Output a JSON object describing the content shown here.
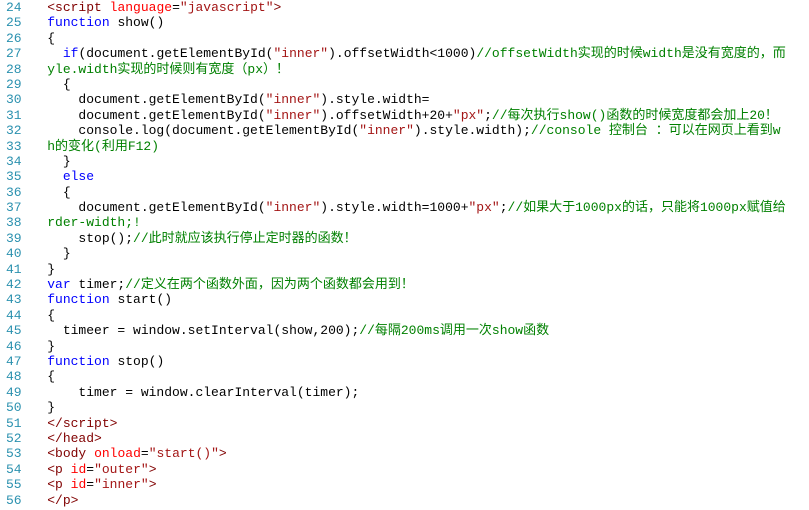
{
  "lineStart": 24,
  "lineEnd": 56,
  "lines": {
    "l24": {
      "indent": "  ",
      "parts": [
        {
          "t": "<",
          "c": "tag"
        },
        {
          "t": "script",
          "c": "tag"
        },
        {
          "t": " ",
          "c": "plain"
        },
        {
          "t": "language",
          "c": "attr"
        },
        {
          "t": "=",
          "c": "plain"
        },
        {
          "t": "\"javascript\"",
          "c": "str"
        },
        {
          "t": ">",
          "c": "tag"
        }
      ]
    },
    "l25": {
      "indent": "  ",
      "parts": [
        {
          "t": "function",
          "c": "kw"
        },
        {
          "t": " show()",
          "c": "plain"
        }
      ]
    },
    "l26": {
      "indent": "  ",
      "parts": [
        {
          "t": "{",
          "c": "plain"
        }
      ]
    },
    "l27": {
      "indent": "    ",
      "parts": [
        {
          "t": "if",
          "c": "kw"
        },
        {
          "t": "(document.getElementById(",
          "c": "plain"
        },
        {
          "t": "\"inner\"",
          "c": "str"
        },
        {
          "t": ").offsetWidth<1000)",
          "c": "plain"
        },
        {
          "t": "//offsetWidth实现的时候width是没有宽度的，而",
          "c": "cm"
        }
      ]
    },
    "l28": {
      "indent": "  ",
      "parts": [
        {
          "t": "yle.width实现的时候则有宽度（px）！",
          "c": "cm"
        }
      ]
    },
    "l29": {
      "indent": "    ",
      "parts": [
        {
          "t": "{",
          "c": "plain"
        }
      ]
    },
    "l30": {
      "indent": "      ",
      "parts": [
        {
          "t": "document.getElementById(",
          "c": "plain"
        },
        {
          "t": "\"inner\"",
          "c": "str"
        },
        {
          "t": ").style.width=",
          "c": "plain"
        }
      ]
    },
    "l31": {
      "indent": "      ",
      "parts": [
        {
          "t": "document.getElementById(",
          "c": "plain"
        },
        {
          "t": "\"inner\"",
          "c": "str"
        },
        {
          "t": ").offsetWidth+20+",
          "c": "plain"
        },
        {
          "t": "\"px\"",
          "c": "str"
        },
        {
          "t": ";",
          "c": "plain"
        },
        {
          "t": "//每次执行show()函数的时候宽度都会加上20！",
          "c": "cm"
        }
      ]
    },
    "l32": {
      "indent": "      ",
      "parts": [
        {
          "t": "console.log(document.getElementById(",
          "c": "plain"
        },
        {
          "t": "\"inner\"",
          "c": "str"
        },
        {
          "t": ").style.width);",
          "c": "plain"
        },
        {
          "t": "//console 控制台 ：可以在网页上看到w",
          "c": "cm"
        }
      ]
    },
    "l33": {
      "indent": "  ",
      "parts": [
        {
          "t": "h的变化(利用F12)",
          "c": "cm"
        }
      ]
    },
    "l34": {
      "indent": "    ",
      "parts": [
        {
          "t": "}",
          "c": "plain"
        }
      ]
    },
    "l35": {
      "indent": "    ",
      "parts": [
        {
          "t": "else",
          "c": "kw"
        }
      ]
    },
    "l36": {
      "indent": "    ",
      "parts": [
        {
          "t": "{",
          "c": "plain"
        }
      ]
    },
    "l37": {
      "indent": "      ",
      "parts": [
        {
          "t": "document.getElementById(",
          "c": "plain"
        },
        {
          "t": "\"inner\"",
          "c": "str"
        },
        {
          "t": ").style.width=1000+",
          "c": "plain"
        },
        {
          "t": "\"px\"",
          "c": "str"
        },
        {
          "t": ";",
          "c": "plain"
        },
        {
          "t": "//如果大于1000px的话，只能将1000px赋值给",
          "c": "cm"
        }
      ]
    },
    "l38": {
      "indent": "  ",
      "parts": [
        {
          "t": "rder-width;!",
          "c": "cm"
        }
      ]
    },
    "l39": {
      "indent": "      ",
      "parts": [
        {
          "t": "stop();",
          "c": "plain"
        },
        {
          "t": "//此时就应该执行停止定时器的函数！",
          "c": "cm"
        }
      ]
    },
    "l40": {
      "indent": "    ",
      "parts": [
        {
          "t": "}",
          "c": "plain"
        }
      ]
    },
    "l41": {
      "indent": "  ",
      "parts": [
        {
          "t": "}",
          "c": "plain"
        }
      ]
    },
    "l42": {
      "indent": "  ",
      "parts": [
        {
          "t": "var",
          "c": "kw"
        },
        {
          "t": " timer;",
          "c": "plain"
        },
        {
          "t": "//定义在两个函数外面，因为两个函数都会用到！",
          "c": "cm"
        }
      ]
    },
    "l43": {
      "indent": "  ",
      "parts": [
        {
          "t": "function",
          "c": "kw"
        },
        {
          "t": " start()",
          "c": "plain"
        }
      ]
    },
    "l44": {
      "indent": "  ",
      "parts": [
        {
          "t": "{",
          "c": "plain"
        }
      ]
    },
    "l45": {
      "indent": "    ",
      "parts": [
        {
          "t": "timeer = window.setInterval(show,200);",
          "c": "plain"
        },
        {
          "t": "//每隔200ms调用一次show函数",
          "c": "cm"
        }
      ]
    },
    "l46": {
      "indent": "  ",
      "parts": [
        {
          "t": "}",
          "c": "plain"
        }
      ]
    },
    "l47": {
      "indent": "  ",
      "parts": [
        {
          "t": "function",
          "c": "kw"
        },
        {
          "t": " stop()",
          "c": "plain"
        }
      ]
    },
    "l48": {
      "indent": "  ",
      "parts": [
        {
          "t": "{",
          "c": "plain"
        }
      ]
    },
    "l49": {
      "indent": "      ",
      "parts": [
        {
          "t": "timer = window.clearInterval(timer);",
          "c": "plain"
        }
      ]
    },
    "l50": {
      "indent": "  ",
      "parts": [
        {
          "t": "}",
          "c": "plain"
        }
      ]
    },
    "l51": {
      "indent": "  ",
      "parts": [
        {
          "t": "</",
          "c": "tag"
        },
        {
          "t": "script",
          "c": "tag"
        },
        {
          "t": ">",
          "c": "tag"
        }
      ]
    },
    "l52": {
      "indent": "  ",
      "parts": [
        {
          "t": "</",
          "c": "tag"
        },
        {
          "t": "head",
          "c": "tag"
        },
        {
          "t": ">",
          "c": "tag"
        }
      ]
    },
    "l53": {
      "indent": "  ",
      "parts": [
        {
          "t": "<",
          "c": "tag"
        },
        {
          "t": "body",
          "c": "tag"
        },
        {
          "t": " ",
          "c": "plain"
        },
        {
          "t": "onload",
          "c": "attr"
        },
        {
          "t": "=",
          "c": "plain"
        },
        {
          "t": "\"start()\"",
          "c": "str"
        },
        {
          "t": ">",
          "c": "tag"
        }
      ]
    },
    "l54": {
      "indent": "  ",
      "parts": [
        {
          "t": "<",
          "c": "tag"
        },
        {
          "t": "p",
          "c": "tag"
        },
        {
          "t": " ",
          "c": "plain"
        },
        {
          "t": "id",
          "c": "attr"
        },
        {
          "t": "=",
          "c": "plain"
        },
        {
          "t": "\"outer\"",
          "c": "str"
        },
        {
          "t": ">",
          "c": "tag"
        }
      ]
    },
    "l55": {
      "indent": "  ",
      "parts": [
        {
          "t": "<",
          "c": "tag"
        },
        {
          "t": "p",
          "c": "tag"
        },
        {
          "t": " ",
          "c": "plain"
        },
        {
          "t": "id",
          "c": "attr"
        },
        {
          "t": "=",
          "c": "plain"
        },
        {
          "t": "\"inner\"",
          "c": "str"
        },
        {
          "t": ">",
          "c": "tag"
        }
      ]
    },
    "l56": {
      "indent": "  ",
      "parts": [
        {
          "t": "<",
          "c": "tag"
        },
        {
          "t": "/p",
          "c": "tag"
        },
        {
          "t": ">",
          "c": "tag"
        }
      ]
    }
  }
}
